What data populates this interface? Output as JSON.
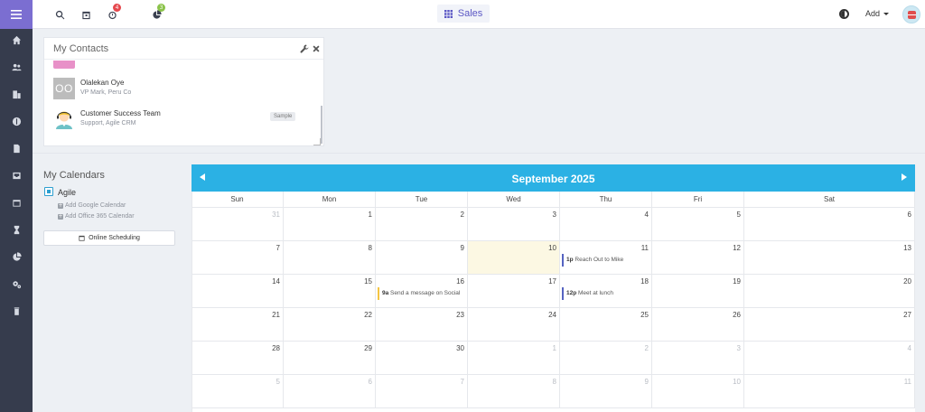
{
  "topbar": {
    "reminder_badge": "4",
    "notif_badge": "3",
    "dashboard_label": "Sales",
    "add_label": "Add"
  },
  "contacts_widget": {
    "title": "My Contacts",
    "contacts": [
      {
        "initials": "OO",
        "name": "Olalekan Oye",
        "sub": "VP Mark, Peru Co"
      },
      {
        "name": "Customer Success Team",
        "sub": "Support, Agile CRM",
        "tag": "Sample"
      }
    ]
  },
  "my_calendars": {
    "title": "My Calendars",
    "agile_label": "Agile",
    "add_google": "Add Google Calendar",
    "add_office": "Add Office 365 Calendar",
    "online_scheduling": "Online Scheduling"
  },
  "calendar": {
    "month_title": "September 2025",
    "days_of_week": [
      "Sun",
      "Mon",
      "Tue",
      "Wed",
      "Thu",
      "Fri",
      "Sat"
    ],
    "weeks": [
      [
        {
          "d": "31",
          "m": true
        },
        {
          "d": "1"
        },
        {
          "d": "2"
        },
        {
          "d": "3"
        },
        {
          "d": "4"
        },
        {
          "d": "5"
        },
        {
          "d": "6"
        }
      ],
      [
        {
          "d": "7"
        },
        {
          "d": "8"
        },
        {
          "d": "9"
        },
        {
          "d": "10",
          "today": true
        },
        {
          "d": "11",
          "event": {
            "time": "1p",
            "title": "Reach Out to Mike",
            "color": "blue"
          }
        },
        {
          "d": "12"
        },
        {
          "d": "13"
        }
      ],
      [
        {
          "d": "14"
        },
        {
          "d": "15"
        },
        {
          "d": "16",
          "event": {
            "time": "9a",
            "title": "Send a message on Social",
            "color": "yellow"
          }
        },
        {
          "d": "17"
        },
        {
          "d": "18",
          "event": {
            "time": "12p",
            "title": "Meet at lunch",
            "color": "blue"
          }
        },
        {
          "d": "19"
        },
        {
          "d": "20"
        }
      ],
      [
        {
          "d": "21"
        },
        {
          "d": "22"
        },
        {
          "d": "23"
        },
        {
          "d": "24"
        },
        {
          "d": "25"
        },
        {
          "d": "26"
        },
        {
          "d": "27"
        }
      ],
      [
        {
          "d": "28"
        },
        {
          "d": "29"
        },
        {
          "d": "30"
        },
        {
          "d": "1",
          "m": true
        },
        {
          "d": "2",
          "m": true
        },
        {
          "d": "3",
          "m": true
        },
        {
          "d": "4",
          "m": true
        }
      ],
      [
        {
          "d": "5",
          "m": true
        },
        {
          "d": "6",
          "m": true
        },
        {
          "d": "7",
          "m": true
        },
        {
          "d": "8",
          "m": true
        },
        {
          "d": "9",
          "m": true
        },
        {
          "d": "10",
          "m": true
        },
        {
          "d": "11",
          "m": true
        }
      ]
    ]
  },
  "colors": {
    "accent": "#7b6ed1",
    "calendar_header": "#2bb1e4",
    "today_bg": "#fcf8e3",
    "event_blue": "#5563c1",
    "event_yellow": "#f4c542"
  }
}
